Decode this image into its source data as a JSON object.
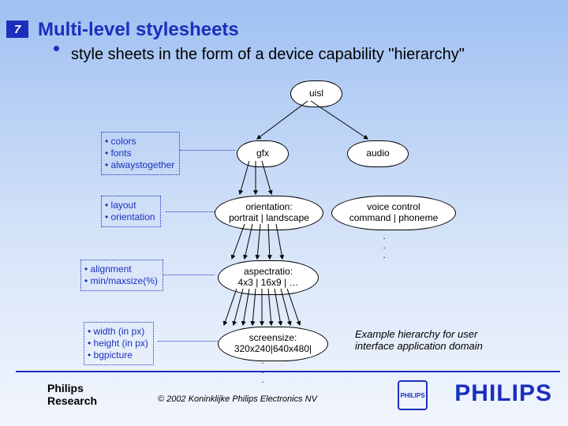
{
  "slide": {
    "number": "7",
    "title": "Multi-level stylesheets"
  },
  "bullet": "style sheets in the form of a device capability \"hierarchy\"",
  "annotations": {
    "a1": [
      "colors",
      "fonts",
      "alwaystogether"
    ],
    "a2": [
      "layout",
      "orientation"
    ],
    "a3": [
      "alignment",
      "min/maxsize(%)"
    ],
    "a4": [
      "width (in px)",
      "height (in px)",
      "bgpicture"
    ]
  },
  "nodes": {
    "root": "uisl",
    "gfx": "gfx",
    "audio": "audio",
    "orient": "orientation:\nportrait | landscape",
    "voice": "voice control\ncommand | phoneme",
    "aspect": "aspectratio:\n4x3 | 16x9 | …",
    "screen": "screensize:\n320x240|640x480|"
  },
  "example": "Example hierarchy for user\ninterface application domain",
  "footer": {
    "org": "Philips\nResearch",
    "copyright": "© 2002 Koninklijke Philips Electronics NV",
    "brand": "PHILIPS",
    "shield": "PHILIPS"
  },
  "dots": ".\n.\n."
}
